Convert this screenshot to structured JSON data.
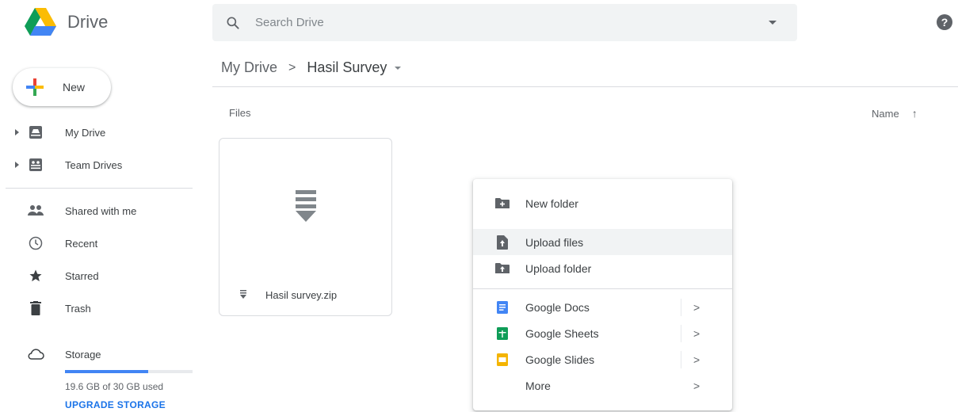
{
  "app": {
    "name": "Drive"
  },
  "search": {
    "placeholder": "Search Drive"
  },
  "help": {
    "glyph": "?"
  },
  "sidebar": {
    "new_label": "New",
    "items": [
      {
        "label": "My Drive",
        "icon": "my-drive-icon"
      },
      {
        "label": "Team Drives",
        "icon": "team-drives-icon"
      },
      {
        "label": "Shared with me",
        "icon": "shared-icon"
      },
      {
        "label": "Recent",
        "icon": "clock-icon"
      },
      {
        "label": "Starred",
        "icon": "star-icon"
      },
      {
        "label": "Trash",
        "icon": "trash-icon"
      },
      {
        "label": "Storage",
        "icon": "cloud-icon"
      }
    ],
    "storage_used_fraction": 0.653,
    "storage_text": "19.6 GB of 30 GB used",
    "upgrade_label": "UPGRADE STORAGE"
  },
  "breadcrumb": {
    "root": "My Drive",
    "separator": ">",
    "current": "Hasil Survey"
  },
  "main": {
    "section_label": "Files",
    "sort_label": "Name",
    "sort_arrow": "↑",
    "files": [
      {
        "name": "Hasil survey.zip",
        "type": "zip"
      }
    ]
  },
  "context_menu": {
    "items": [
      {
        "label": "New folder",
        "icon": "new-folder-icon"
      },
      {
        "label": "Upload files",
        "icon": "upload-file-icon",
        "highlighted": true
      },
      {
        "label": "Upload folder",
        "icon": "upload-folder-icon"
      },
      {
        "label": "Google Docs",
        "icon": "google-docs-icon",
        "submenu": true
      },
      {
        "label": "Google Sheets",
        "icon": "google-sheets-icon",
        "submenu": true
      },
      {
        "label": "Google Slides",
        "icon": "google-slides-icon",
        "submenu": true
      },
      {
        "label": "More",
        "submenu": true
      }
    ],
    "chevron": ">"
  },
  "colors": {
    "accent": "#1a73e8",
    "storage_fill": "#4285f4",
    "docs": "#4285f4",
    "sheets": "#0f9d58",
    "slides": "#f4b400"
  }
}
